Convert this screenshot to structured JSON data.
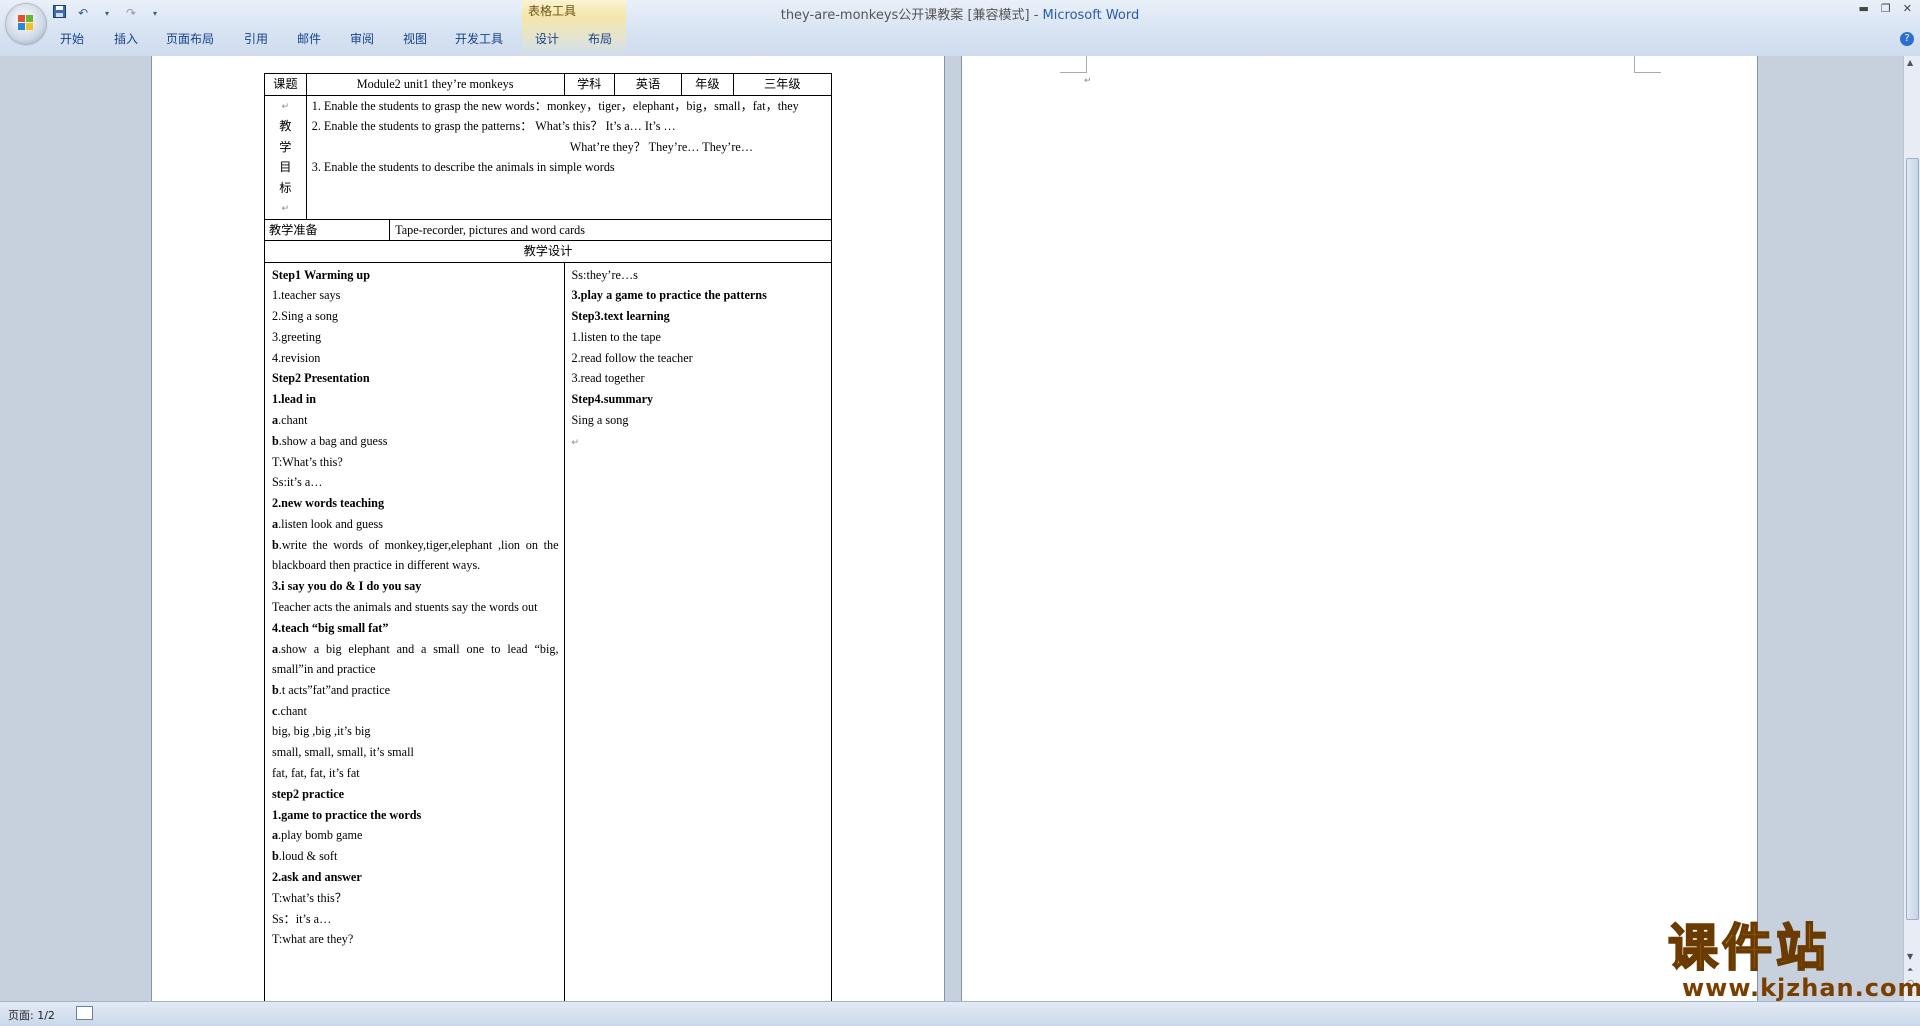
{
  "window": {
    "title": "they-are-monkeys公开课教案 [兼容模式] - ",
    "app_name": "Microsoft Word",
    "contextual_group": "表格工具"
  },
  "ribbon": {
    "tabs": [
      "开始",
      "插入",
      "页面布局",
      "引用",
      "邮件",
      "审阅",
      "视图",
      "开发工具",
      "设计",
      "布局"
    ]
  },
  "quick_access": {
    "save_icon": "save-icon",
    "undo_icon": "undo-icon",
    "redo_icon": "redo-icon"
  },
  "status_bar": {
    "page_info": "页面: 1/2"
  },
  "watermark": {
    "title": "课件站",
    "url": "www.kjzhan.com"
  },
  "document": {
    "header_row": {
      "label_topic": "课题",
      "topic": "Module2 unit1 they’re monkeys",
      "label_subject": "学科",
      "subject": "英语",
      "label_grade": "年级",
      "grade": "三年级"
    },
    "objectives_label": "教学目标",
    "objectives_label_chars": [
      "教",
      "学",
      "目",
      "标"
    ],
    "objectives": [
      "1. Enable the students to grasp the new words：monkey，tiger，elephant，big，small，fat，they",
      "2. Enable the students to grasp the patterns： What’s this？ It’s a… It’s …",
      "What’re they？ They’re… They’re…",
      "3. Enable the students to describe the animals in simple words"
    ],
    "prep_label": "教学准备",
    "prep": "Tape-recorder, pictures and word cards",
    "design_label": "教学设计",
    "left_column": [
      {
        "text": "Step1 Warming up",
        "bold": true
      },
      {
        "text": "1.teacher says",
        "bold": false
      },
      {
        "text": "2.Sing a song",
        "bold": false
      },
      {
        "text": "3.greeting",
        "bold": false
      },
      {
        "text": "4.revision",
        "bold": false
      },
      {
        "text": "Step2 Presentation",
        "bold": true
      },
      {
        "text": "1.lead in",
        "bold": true
      },
      {
        "prefix": "a",
        "text": ".chant",
        "bold": false
      },
      {
        "prefix": "b",
        "text": ".show a bag and guess",
        "bold": false
      },
      {
        "text": "T:What’s this?",
        "bold": false
      },
      {
        "text": "Ss:it’s a…",
        "bold": false
      },
      {
        "text": "2.new words teaching",
        "bold": true
      },
      {
        "prefix": "a",
        "text": ".listen look and guess",
        "bold": false
      },
      {
        "prefix": "b",
        "text": ".write the words of monkey,tiger,elephant ,lion on the blackboard then practice in different ways.",
        "bold": false
      },
      {
        "text": "3.i say you do & I do you say",
        "bold": true
      },
      {
        "text": "Teacher acts the animals and stuents say the words out",
        "bold": false
      },
      {
        "text": "4.teach “big small fat”",
        "bold": true
      },
      {
        "prefix": "a",
        "text": ".show a big elephant and a small one to lead “big, small”in and practice",
        "bold": false
      },
      {
        "prefix": "b",
        "text": ".t acts”fat”and practice",
        "bold": false
      },
      {
        "prefix": "c",
        "text": ".chant",
        "bold": false
      },
      {
        "text": "big, big ,big ,it’s big",
        "bold": false
      },
      {
        "text": "small, small, small, it’s small",
        "bold": false
      },
      {
        "text": "fat, fat, fat, it’s fat",
        "bold": false
      },
      {
        "text": "step2 practice",
        "bold": true
      },
      {
        "text": "1.game to practice the words",
        "bold": true
      },
      {
        "prefix": "a",
        "text": ".play bomb game",
        "bold": false
      },
      {
        "prefix": "b",
        "text": ".loud & soft",
        "bold": false
      },
      {
        "text": "2.ask and answer",
        "bold": true
      },
      {
        "text": "T:what’s this？",
        "bold": false
      },
      {
        "text": "Ss：it’s a…",
        "bold": false
      },
      {
        "text": "T:what are they?",
        "bold": false
      }
    ],
    "right_column": [
      {
        "text": "Ss:they’re…s",
        "bold": false
      },
      {
        "text": "3.play a game to practice the patterns",
        "bold": true
      },
      {
        "text": "Step3.text learning",
        "bold": true
      },
      {
        "text": "1.listen to the tape",
        "bold": false
      },
      {
        "text": "2.read follow the teacher",
        "bold": false
      },
      {
        "text": "3.read together",
        "bold": false
      },
      {
        "text": "Step4.summary",
        "bold": true
      },
      {
        "text": "Sing a song",
        "bold": false
      },
      {
        "text": "",
        "bold": false
      }
    ]
  }
}
